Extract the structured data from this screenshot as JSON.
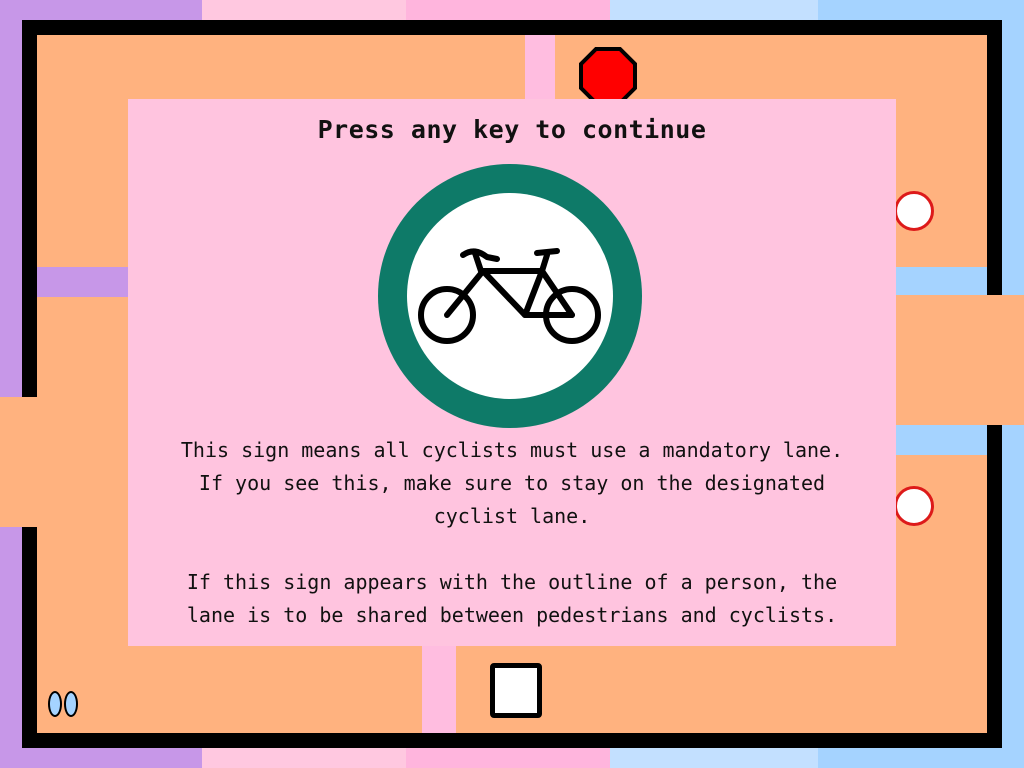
{
  "prompt": {
    "title": "Press any key to continue",
    "paragraph_1": "This sign means all cyclists must use a mandatory lane.\nIf you see this, make sure to stay on the designated\ncyclist lane.",
    "paragraph_2": "If this sign appears with the outline of a person, the\nlane is to be shared between pedestrians and cyclists."
  },
  "sign": {
    "icon": "bicycle-icon",
    "ring_color": "#0e7a68",
    "face_color": "#ffffff"
  },
  "colors": {
    "floor": "#ffb27f",
    "wall": "#000000",
    "stop_sign": "#ff0000",
    "modal_background": "#ffc4df"
  },
  "hud": {
    "lives": 2
  }
}
